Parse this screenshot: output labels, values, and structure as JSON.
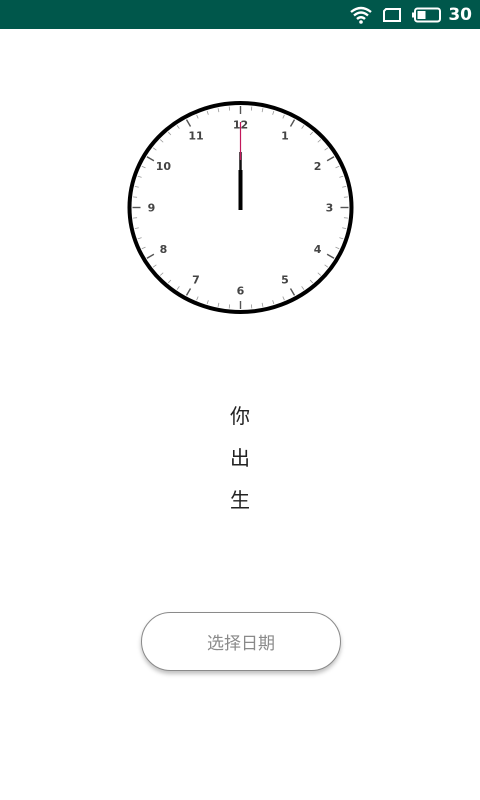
{
  "status_bar": {
    "battery_level": "30",
    "icons": [
      "wifi-icon",
      "screen-icon",
      "battery-icon"
    ]
  },
  "clock": {
    "numbers": [
      "12",
      "1",
      "2",
      "3",
      "4",
      "5",
      "6",
      "7",
      "8",
      "9",
      "10",
      "11"
    ],
    "time": "12:00"
  },
  "main": {
    "vertical_text": [
      "你",
      "出",
      "生"
    ]
  },
  "button": {
    "label": "选择日期"
  },
  "colors": {
    "status_bar_bg": "#00574b",
    "second_hand": "#c2185b"
  }
}
